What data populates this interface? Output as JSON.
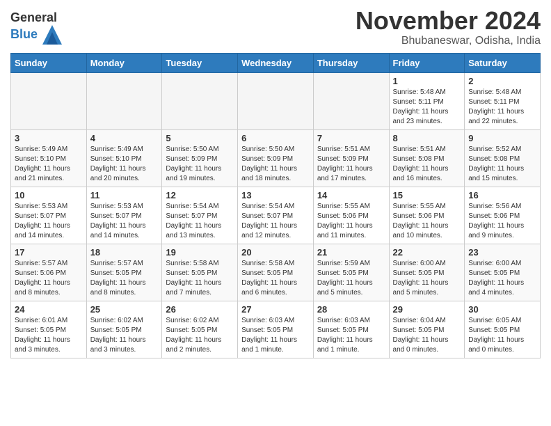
{
  "header": {
    "logo_line1": "General",
    "logo_line2": "Blue",
    "title": "November 2024",
    "subtitle": "Bhubaneswar, Odisha, India"
  },
  "calendar": {
    "headers": [
      "Sunday",
      "Monday",
      "Tuesday",
      "Wednesday",
      "Thursday",
      "Friday",
      "Saturday"
    ],
    "weeks": [
      [
        {
          "day": "",
          "empty": true
        },
        {
          "day": "",
          "empty": true
        },
        {
          "day": "",
          "empty": true
        },
        {
          "day": "",
          "empty": true
        },
        {
          "day": "",
          "empty": true
        },
        {
          "day": "1",
          "sunrise": "5:48 AM",
          "sunset": "5:11 PM",
          "daylight": "11 hours and 23 minutes."
        },
        {
          "day": "2",
          "sunrise": "5:48 AM",
          "sunset": "5:11 PM",
          "daylight": "11 hours and 22 minutes."
        }
      ],
      [
        {
          "day": "3",
          "sunrise": "5:49 AM",
          "sunset": "5:10 PM",
          "daylight": "11 hours and 21 minutes."
        },
        {
          "day": "4",
          "sunrise": "5:49 AM",
          "sunset": "5:10 PM",
          "daylight": "11 hours and 20 minutes."
        },
        {
          "day": "5",
          "sunrise": "5:50 AM",
          "sunset": "5:09 PM",
          "daylight": "11 hours and 19 minutes."
        },
        {
          "day": "6",
          "sunrise": "5:50 AM",
          "sunset": "5:09 PM",
          "daylight": "11 hours and 18 minutes."
        },
        {
          "day": "7",
          "sunrise": "5:51 AM",
          "sunset": "5:09 PM",
          "daylight": "11 hours and 17 minutes."
        },
        {
          "day": "8",
          "sunrise": "5:51 AM",
          "sunset": "5:08 PM",
          "daylight": "11 hours and 16 minutes."
        },
        {
          "day": "9",
          "sunrise": "5:52 AM",
          "sunset": "5:08 PM",
          "daylight": "11 hours and 15 minutes."
        }
      ],
      [
        {
          "day": "10",
          "sunrise": "5:53 AM",
          "sunset": "5:07 PM",
          "daylight": "11 hours and 14 minutes."
        },
        {
          "day": "11",
          "sunrise": "5:53 AM",
          "sunset": "5:07 PM",
          "daylight": "11 hours and 14 minutes."
        },
        {
          "day": "12",
          "sunrise": "5:54 AM",
          "sunset": "5:07 PM",
          "daylight": "11 hours and 13 minutes."
        },
        {
          "day": "13",
          "sunrise": "5:54 AM",
          "sunset": "5:07 PM",
          "daylight": "11 hours and 12 minutes."
        },
        {
          "day": "14",
          "sunrise": "5:55 AM",
          "sunset": "5:06 PM",
          "daylight": "11 hours and 11 minutes."
        },
        {
          "day": "15",
          "sunrise": "5:55 AM",
          "sunset": "5:06 PM",
          "daylight": "11 hours and 10 minutes."
        },
        {
          "day": "16",
          "sunrise": "5:56 AM",
          "sunset": "5:06 PM",
          "daylight": "11 hours and 9 minutes."
        }
      ],
      [
        {
          "day": "17",
          "sunrise": "5:57 AM",
          "sunset": "5:06 PM",
          "daylight": "11 hours and 8 minutes."
        },
        {
          "day": "18",
          "sunrise": "5:57 AM",
          "sunset": "5:05 PM",
          "daylight": "11 hours and 8 minutes."
        },
        {
          "day": "19",
          "sunrise": "5:58 AM",
          "sunset": "5:05 PM",
          "daylight": "11 hours and 7 minutes."
        },
        {
          "day": "20",
          "sunrise": "5:58 AM",
          "sunset": "5:05 PM",
          "daylight": "11 hours and 6 minutes."
        },
        {
          "day": "21",
          "sunrise": "5:59 AM",
          "sunset": "5:05 PM",
          "daylight": "11 hours and 5 minutes."
        },
        {
          "day": "22",
          "sunrise": "6:00 AM",
          "sunset": "5:05 PM",
          "daylight": "11 hours and 5 minutes."
        },
        {
          "day": "23",
          "sunrise": "6:00 AM",
          "sunset": "5:05 PM",
          "daylight": "11 hours and 4 minutes."
        }
      ],
      [
        {
          "day": "24",
          "sunrise": "6:01 AM",
          "sunset": "5:05 PM",
          "daylight": "11 hours and 3 minutes."
        },
        {
          "day": "25",
          "sunrise": "6:02 AM",
          "sunset": "5:05 PM",
          "daylight": "11 hours and 3 minutes."
        },
        {
          "day": "26",
          "sunrise": "6:02 AM",
          "sunset": "5:05 PM",
          "daylight": "11 hours and 2 minutes."
        },
        {
          "day": "27",
          "sunrise": "6:03 AM",
          "sunset": "5:05 PM",
          "daylight": "11 hours and 1 minute."
        },
        {
          "day": "28",
          "sunrise": "6:03 AM",
          "sunset": "5:05 PM",
          "daylight": "11 hours and 1 minute."
        },
        {
          "day": "29",
          "sunrise": "6:04 AM",
          "sunset": "5:05 PM",
          "daylight": "11 hours and 0 minutes."
        },
        {
          "day": "30",
          "sunrise": "6:05 AM",
          "sunset": "5:05 PM",
          "daylight": "11 hours and 0 minutes."
        }
      ]
    ]
  }
}
